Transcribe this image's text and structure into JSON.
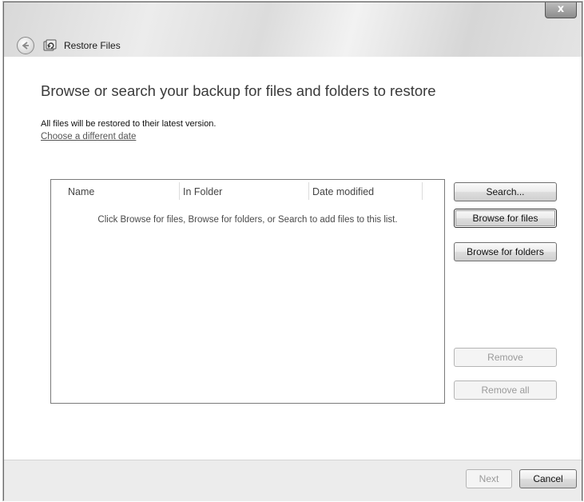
{
  "window": {
    "title": "Restore Files",
    "close_label": "x"
  },
  "main": {
    "heading": "Browse or search your backup for files and folders to restore",
    "info": "All files will be restored to their latest version.",
    "change_date_link": "Choose a different date"
  },
  "list": {
    "columns": [
      "Name",
      "In Folder",
      "Date modified"
    ],
    "empty_message": "Click Browse for files, Browse for folders, or Search to add files to this list."
  },
  "side_buttons": {
    "search": "Search...",
    "browse_files": "Browse for files",
    "browse_folders": "Browse for folders",
    "remove": "Remove",
    "remove_all": "Remove all"
  },
  "footer": {
    "next": "Next",
    "cancel": "Cancel"
  }
}
